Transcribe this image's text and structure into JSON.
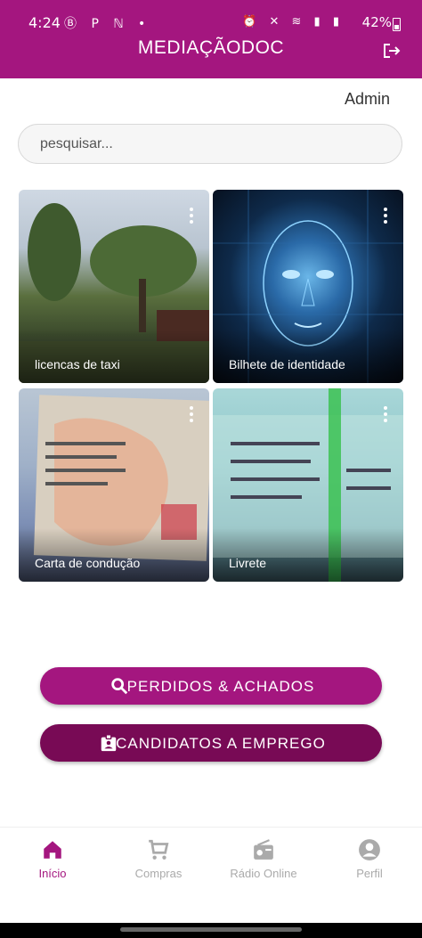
{
  "status_bar": {
    "time": "4:24",
    "left_icons": "Ⓑ P ℕ •",
    "right_icons": "⏰ ✕ ≋ ▮ ▮",
    "battery": "42%"
  },
  "header": {
    "title": "MEDIAÇÃODOC",
    "logout_icon": "logout-icon"
  },
  "user": {
    "name": "Admin"
  },
  "search": {
    "placeholder": "pesquisar...",
    "value": ""
  },
  "cards": [
    {
      "label": "licencas de taxi"
    },
    {
      "label": "Bilhete de identidade"
    },
    {
      "label": "Carta de condução"
    },
    {
      "label": "Livrete"
    }
  ],
  "buttons": {
    "lost_found": "PERDIDOS & ACHADOS",
    "job_candidates": "CANDIDATOS A EMPREGO"
  },
  "nav": {
    "items": [
      {
        "label": "Início",
        "icon": "home-icon",
        "active": true
      },
      {
        "label": "Compras",
        "icon": "cart-icon",
        "active": false
      },
      {
        "label": "Rádio Online",
        "icon": "radio-icon",
        "active": false
      },
      {
        "label": "Perfil",
        "icon": "account-icon",
        "active": false
      }
    ]
  },
  "colors": {
    "primary": "#a4167f",
    "secondary": "#780a55"
  }
}
